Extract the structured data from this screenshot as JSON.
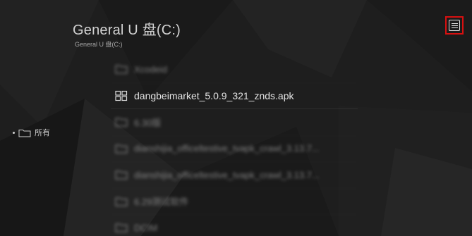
{
  "header": {
    "title": "General U 盘(C:)",
    "path": "General U 盘(C:)"
  },
  "toolbar": {
    "menu_icon": "menu-icon"
  },
  "sidebar": {
    "items": [
      {
        "label": "所有",
        "icon": "folder-icon"
      }
    ]
  },
  "files": [
    {
      "name": "Xcodeid",
      "icon": "folder-icon",
      "blurred": true
    },
    {
      "name": "dangbeimarket_5.0.9_321_znds.apk",
      "icon": "apk-grid-icon",
      "blurred": false
    },
    {
      "name": "6.30版",
      "icon": "folder-icon",
      "blurred": true
    },
    {
      "name": "dianshijia_officeltestive_tvapk_crawl_3.13.7...",
      "icon": "folder-icon",
      "blurred": true
    },
    {
      "name": "dianshijia_officeltestive_tvapk_crawl_3.13.7...",
      "icon": "folder-icon",
      "blurred": true
    },
    {
      "name": "6.29测试软件",
      "icon": "folder-icon",
      "blurred": true
    },
    {
      "name": "DCIM",
      "icon": "folder-icon",
      "blurred": true
    }
  ],
  "colors": {
    "background": "#1e1e1e",
    "text": "#cfcfcf",
    "focus_border": "#d81010"
  }
}
